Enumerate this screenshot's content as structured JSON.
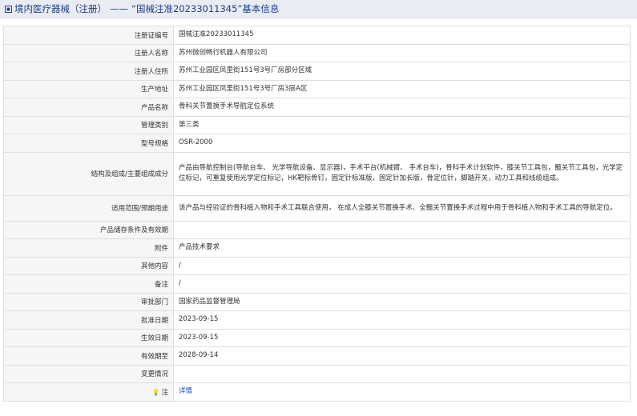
{
  "header": {
    "section": "境内医疗器械（注册）",
    "separator": "——",
    "title": "“国械注准20233011345”基本信息"
  },
  "rows": [
    {
      "label": "注册证编号",
      "value": "国械注准20233011345"
    },
    {
      "label": "注册人名称",
      "value": "苏州微创畅行机器人有限公司"
    },
    {
      "label": "注册人住所",
      "value": "苏州工业园区凤里街151号3号厂房部分区域"
    },
    {
      "label": "生产地址",
      "value": "苏州工业园区凤里街151号3号厂房3层A区"
    },
    {
      "label": "产品名称",
      "value": "骨科关节置换手术导航定位系统"
    },
    {
      "label": "管理类别",
      "value": "第三类"
    },
    {
      "label": "型号规格",
      "value": "OSR-2000"
    },
    {
      "label": "结构及组成/主要组成成分",
      "value": "产品由导航控制台(导航台车、 光学导航设备、显示器)，手术平台(机械臂、 手术台车)，骨科手术计划软件，膝关节工具包，髋关节工具包，光学定位标记，可重复使用光学定位标记，HK靶标骨钉，固定针标准版，固定针加长版，骨定位针，脚踏开关，动力工具和线缆组成。"
    },
    {
      "label": "适用范围/预期用途",
      "value": "该产品与经验证的骨科植入物和手术工具联合使用， 在成人全膝关节置换手术、全髋关节置换手术过程中用于骨科植入物和手术工具的导航定位。"
    },
    {
      "label": "产品储存条件及有效期",
      "value": ""
    },
    {
      "label": "附件",
      "value": "产品技术要求"
    },
    {
      "label": "其他内容",
      "value": "/"
    },
    {
      "label": "备注",
      "value": "/"
    },
    {
      "label": "审批部门",
      "value": "国家药品监督管理局"
    },
    {
      "label": "批准日期",
      "value": "2023-09-15"
    },
    {
      "label": "生效日期",
      "value": "2023-09-15"
    },
    {
      "label": "有效期至",
      "value": "2028-09-14"
    },
    {
      "label": "变更情况",
      "value": ""
    },
    {
      "label": "注",
      "value": "详情"
    }
  ],
  "colors": {
    "header_bg": "#e9ecf3",
    "header_text": "#1a3f8c",
    "label_bg": "#f6f6f6",
    "link": "#1a52c4"
  },
  "icons": [
    "square-bullet-icon",
    "lightbulb-icon"
  ]
}
